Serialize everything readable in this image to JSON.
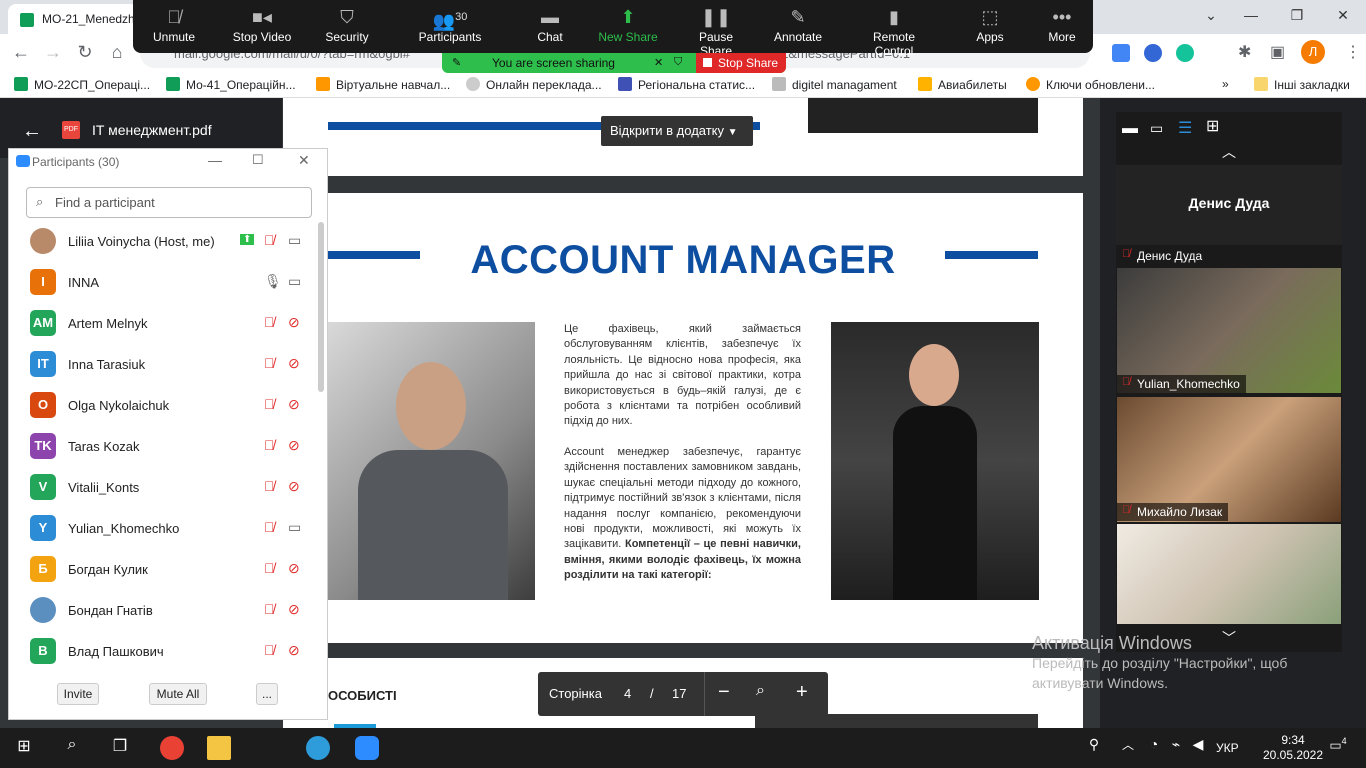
{
  "browser": {
    "tab_title": "МО-21_Menedzh",
    "url": "mail.google.com/mail/u/0/?tab=rm&ogbl#",
    "url_suffix": "=1&messagePartId=0.1",
    "bookmarks": [
      "МО-22СП_Операці...",
      "Мо-41_Операційн...",
      "Віртуальне навчал...",
      "Онлайн переклада...",
      "Регіональна статис...",
      "digitel managament",
      "Авиабилеты",
      "Ключи обновлени...",
      "Інші закладки"
    ],
    "more_bookmarks": "»",
    "profile_letter": "Л"
  },
  "zoom_toolbar": {
    "items": [
      {
        "label": "Unmute",
        "icon": "mic-off-icon"
      },
      {
        "label": "Stop Video",
        "icon": "video-icon"
      },
      {
        "label": "Security",
        "icon": "shield-icon"
      },
      {
        "label": "Participants",
        "icon": "people-icon",
        "count": "30"
      },
      {
        "label": "Chat",
        "icon": "chat-icon"
      },
      {
        "label": "New Share",
        "icon": "share-icon"
      },
      {
        "label": "Pause Share",
        "icon": "pause-icon"
      },
      {
        "label": "Annotate",
        "icon": "pen-icon"
      },
      {
        "label": "Remote Control",
        "icon": "mouse-icon"
      },
      {
        "label": "Apps",
        "icon": "apps-icon"
      },
      {
        "label": "More",
        "icon": "more-icon"
      }
    ],
    "sharing_text": "You are screen sharing",
    "stop_share": "Stop Share"
  },
  "viewer": {
    "file_name": "IT менеджмент.pdf",
    "open_in_app": "Відкрити в додатку",
    "page_title": "ACCOUNT MANAGER",
    "para1": "Це фахівець, який займається обслуговуванням клієнтів, забезпечує їх лояльність. Це відносно нова професія, яка прийшла до нас зі світової практики, котра використовується в будь–якій галузі, де є робота з клієнтами та потрібен особливий підхід до них.",
    "para2": "Account менеджер забезпечує, гарантує здійснення поставлених замовником завдань, шукає спеціальні методи підходу до кожного, підтримує постійний зв'язок з клієнтами, після надання послуг компанією, рекомендуючи нові продукти, можливості, які можуть їх зацікавити.",
    "para2_bold": "Компетенції – це певні навички, вміння, якими володіє фахівець, їх можна розділити на такі категорії:",
    "next_heading": "ОСОБИСТІ",
    "pager": {
      "label": "Сторінка",
      "current": "4",
      "sep": "/",
      "total": "17",
      "zoom_out": "−",
      "zoom_in": "+"
    }
  },
  "participants_panel": {
    "title": "Participants (30)",
    "search_placeholder": "Find a participant",
    "participants": [
      {
        "name": "Liliia Voinycha (Host, me)",
        "initials": "",
        "color": "#b88a6a"
      },
      {
        "name": "INNA",
        "initials": "I",
        "color": "#e8710a"
      },
      {
        "name": "Artem Melnyk",
        "initials": "AM",
        "color": "#23a55a"
      },
      {
        "name": "Inna Tarasiuk",
        "initials": "IT",
        "color": "#2d8cd6"
      },
      {
        "name": "Olga Nykolaichuk",
        "initials": "O",
        "color": "#d9480f"
      },
      {
        "name": "Taras Kozak",
        "initials": "TK",
        "color": "#8e44ad"
      },
      {
        "name": "Vitalii_Konts",
        "initials": "V",
        "color": "#23a55a"
      },
      {
        "name": "Yulian_Khomechko",
        "initials": "Y",
        "color": "#2d8cd6"
      },
      {
        "name": "Богдан Кулик",
        "initials": "Б",
        "color": "#f2a30f"
      },
      {
        "name": "Бондан Гнатів",
        "initials": "",
        "color": "#5b8fbf"
      },
      {
        "name": "Влад Пашкович",
        "initials": "В",
        "color": "#23a55a"
      }
    ],
    "invite": "Invite",
    "mute_all": "Mute All",
    "more": "..."
  },
  "gallery": {
    "speaker": "Денис Дуда",
    "tiles": [
      {
        "name": "Денис Дуда"
      },
      {
        "name": "Yulian_Khomechko"
      },
      {
        "name": "Михайло Лизак"
      }
    ]
  },
  "windows_activation": {
    "line1": "Активація Windows",
    "line2": "Перейдіть до розділу \"Настройки\", щоб",
    "line3": "активувати Windows."
  },
  "taskbar": {
    "lang": "УКР",
    "time": "9:34",
    "date": "20.05.2022",
    "notifications": "4"
  }
}
